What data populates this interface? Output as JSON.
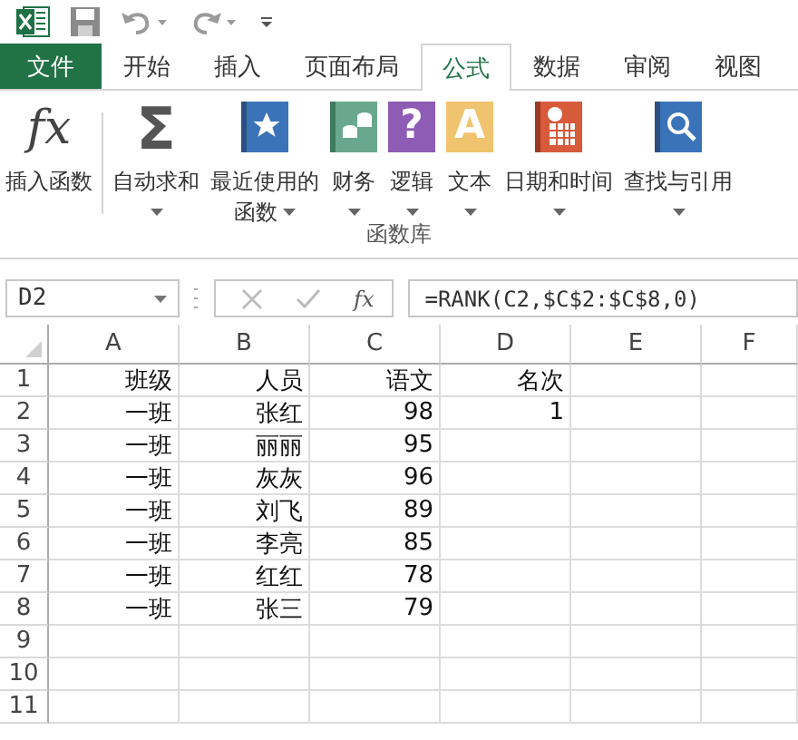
{
  "tabs": [
    {
      "label": "文件",
      "kind": "file",
      "selected": false
    },
    {
      "label": "开始",
      "kind": "tab",
      "selected": false
    },
    {
      "label": "插入",
      "kind": "tab",
      "selected": false
    },
    {
      "label": "页面布局",
      "kind": "tab",
      "selected": false
    },
    {
      "label": "公式",
      "kind": "tab",
      "selected": true
    },
    {
      "label": "数据",
      "kind": "tab",
      "selected": false
    },
    {
      "label": "审阅",
      "kind": "tab",
      "selected": false
    },
    {
      "label": "视图",
      "kind": "tab",
      "selected": false
    }
  ],
  "ribbon": {
    "group_label": "函数库",
    "buttons": [
      {
        "kind": "glyph",
        "glyph": "fx",
        "label": "插入函数",
        "dropdown": false
      },
      {
        "kind": "glyph",
        "glyph": "Σ",
        "label": "自动求和",
        "dropdown": true
      },
      {
        "kind": "star",
        "color": "#3b73b9",
        "label": "最近使用的",
        "label2": "函数",
        "dropdown": true
      },
      {
        "kind": "coins",
        "color": "#6aa88d",
        "label": "财务",
        "dropdown": true
      },
      {
        "kind": "letter",
        "glyph": "?",
        "color": "#8e5bb5",
        "label": "逻辑",
        "dropdown": true
      },
      {
        "kind": "letter",
        "glyph": "A",
        "color": "#f0c36e",
        "label": "文本",
        "dropdown": true
      },
      {
        "kind": "calendar",
        "color": "#d75a3a",
        "label": "日期和时间",
        "dropdown": true
      },
      {
        "kind": "magnifier",
        "color": "#3b73b9",
        "label": "查找与引用",
        "dropdown": true
      }
    ]
  },
  "formula_bar": {
    "name_box": "D2",
    "fx": "fx",
    "formula": "=RANK(C2,$C$2:$C$8,0)"
  },
  "sheet": {
    "columns": [
      "A",
      "B",
      "C",
      "D",
      "E",
      "F"
    ],
    "rows": [
      {
        "number": "1",
        "cells": {
          "A": "班级",
          "B": "人员",
          "C": "语文",
          "D": "名次"
        }
      },
      {
        "number": "2",
        "cells": {
          "A": "一班",
          "B": "张红",
          "C": "98",
          "D": "1"
        }
      },
      {
        "number": "3",
        "cells": {
          "A": "一班",
          "B": "丽丽",
          "C": "95"
        }
      },
      {
        "number": "4",
        "cells": {
          "A": "一班",
          "B": "灰灰",
          "C": "96"
        }
      },
      {
        "number": "5",
        "cells": {
          "A": "一班",
          "B": "刘飞",
          "C": "89"
        }
      },
      {
        "number": "6",
        "cells": {
          "A": "一班",
          "B": "李亮",
          "C": "85"
        }
      },
      {
        "number": "7",
        "cells": {
          "A": "一班",
          "B": "红红",
          "C": "78"
        }
      },
      {
        "number": "8",
        "cells": {
          "A": "一班",
          "B": "张三",
          "C": "79"
        }
      },
      {
        "number": "9",
        "cells": {}
      },
      {
        "number": "10",
        "cells": {}
      },
      {
        "number": "11",
        "cells": {}
      }
    ]
  }
}
